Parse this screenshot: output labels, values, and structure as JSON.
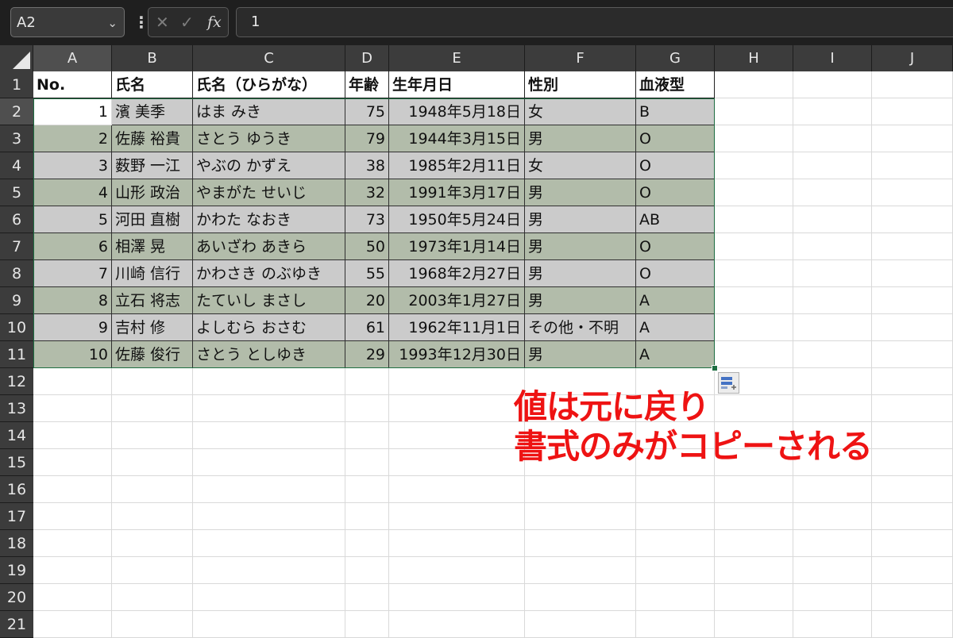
{
  "formula_bar": {
    "name_box": "A2",
    "formula_value": "1",
    "fx_label": "fx",
    "cancel_icon": "cancel-x-icon",
    "enter_icon": "check-icon"
  },
  "columns": [
    "A",
    "B",
    "C",
    "D",
    "E",
    "F",
    "G",
    "H",
    "I",
    "J"
  ],
  "rows": [
    "1",
    "2",
    "3",
    "4",
    "5",
    "6",
    "7",
    "8",
    "9",
    "10",
    "11",
    "12",
    "13",
    "14",
    "15",
    "16",
    "17",
    "18",
    "19",
    "20",
    "21"
  ],
  "header_row": [
    "No.",
    "氏名",
    "氏名（ひらがな）",
    "年齢",
    "生年月日",
    "性別",
    "血液型"
  ],
  "table_rows": [
    [
      "1",
      "濱 美季",
      "はま みき",
      "75",
      "1948年5月18日",
      "女",
      "B"
    ],
    [
      "2",
      "佐藤 裕貴",
      "さとう ゆうき",
      "79",
      "1944年3月15日",
      "男",
      "O"
    ],
    [
      "3",
      "薮野 一江",
      "やぶの かずえ",
      "38",
      "1985年2月11日",
      "女",
      "O"
    ],
    [
      "4",
      "山形 政治",
      "やまがた せいじ",
      "32",
      "1991年3月17日",
      "男",
      "O"
    ],
    [
      "5",
      "河田 直樹",
      "かわた なおき",
      "73",
      "1950年5月24日",
      "男",
      "AB"
    ],
    [
      "6",
      "相澤 晃",
      "あいざわ あきら",
      "50",
      "1973年1月14日",
      "男",
      "O"
    ],
    [
      "7",
      "川崎 信行",
      "かわさき のぶゆき",
      "55",
      "1968年2月27日",
      "男",
      "O"
    ],
    [
      "8",
      "立石 将志",
      "たていし まさし",
      "20",
      "2003年1月27日",
      "男",
      "A"
    ],
    [
      "9",
      "吉村 修",
      "よしむら おさむ",
      "61",
      "1962年11月1日",
      "その他・不明",
      "A"
    ],
    [
      "10",
      "佐藤 俊行",
      "さとう としゆき",
      "29",
      "1993年12月30日",
      "男",
      "A"
    ]
  ],
  "selected_cell": "A2",
  "paste_options_icon": "paste-options-icon",
  "annotation": {
    "line1": "値は元に戻り",
    "line2": "書式のみがコピーされる",
    "color": "#ee1313"
  },
  "colors": {
    "band_gray": "#cbcbcb",
    "band_green": "#b2bcaa",
    "selection_border": "#1e6e42",
    "header_dark": "#3c3c3c"
  }
}
